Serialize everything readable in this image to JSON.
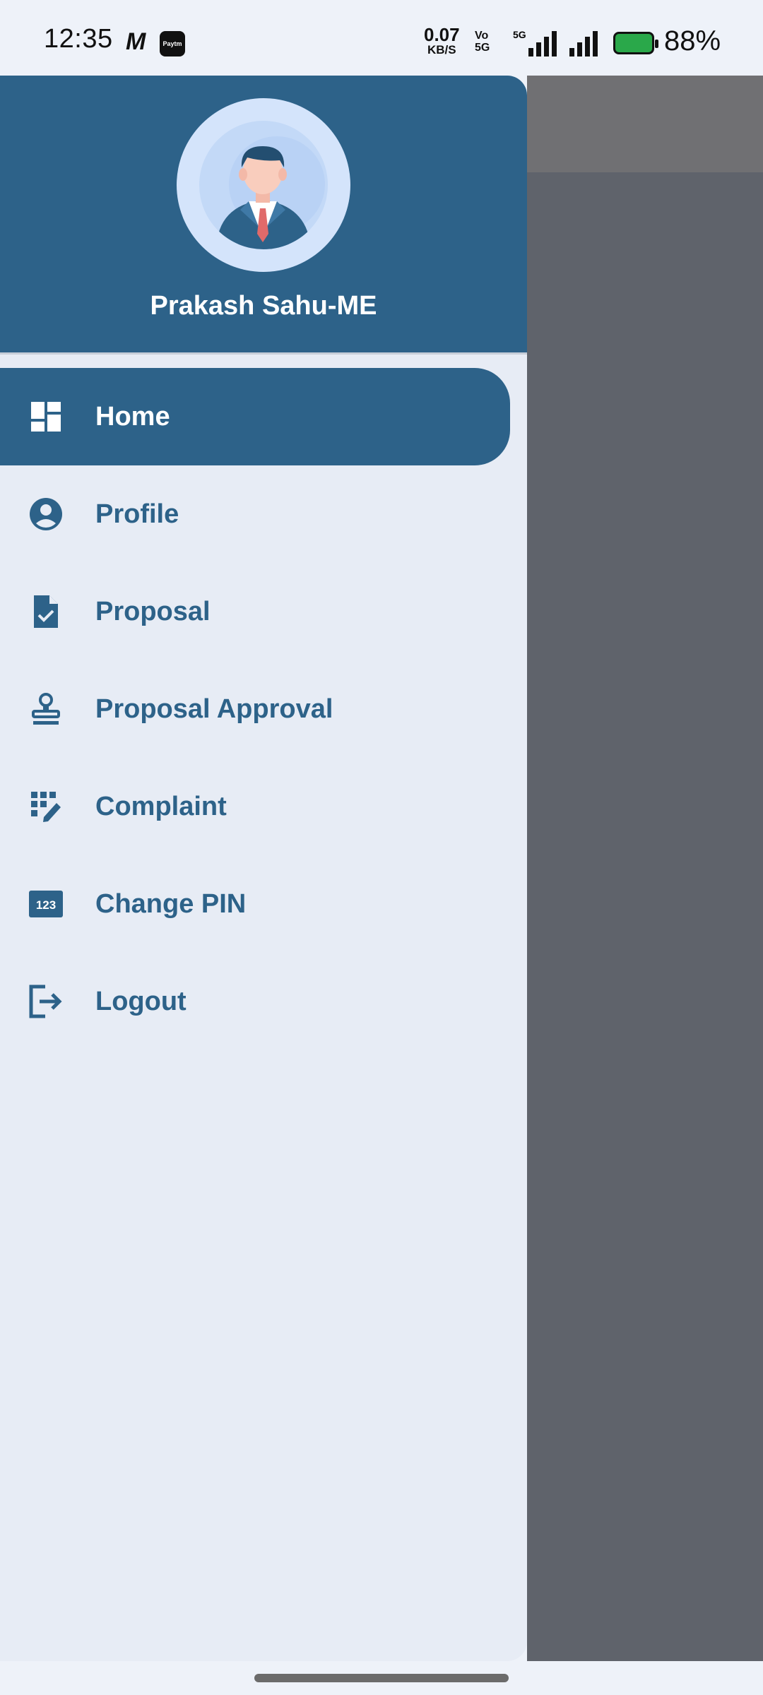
{
  "status_bar": {
    "time": "12:35",
    "m_icon": "M",
    "paytm_label": "Paytm",
    "net_speed_value": "0.07",
    "net_speed_unit": "KB/S",
    "volte_top": "Vo",
    "volte_bottom": "5G",
    "network": "5G",
    "battery_percent": "88%",
    "battery_color": "#2aa84a"
  },
  "drawer": {
    "header_color": "#2d6289",
    "user_name": "Prakash Sahu-ME",
    "items": [
      {
        "label": "Home",
        "icon": "dashboard-icon",
        "active": true
      },
      {
        "label": "Profile",
        "icon": "account-circle-icon"
      },
      {
        "label": "Proposal",
        "icon": "document-check-icon"
      },
      {
        "label": "Proposal Approval",
        "icon": "stamp-icon"
      },
      {
        "label": "Complaint",
        "icon": "edit-grid-icon"
      },
      {
        "label": "Change PIN",
        "icon": "pin-123-icon",
        "icon_text": "123"
      },
      {
        "label": "Logout",
        "icon": "logout-icon"
      }
    ]
  }
}
